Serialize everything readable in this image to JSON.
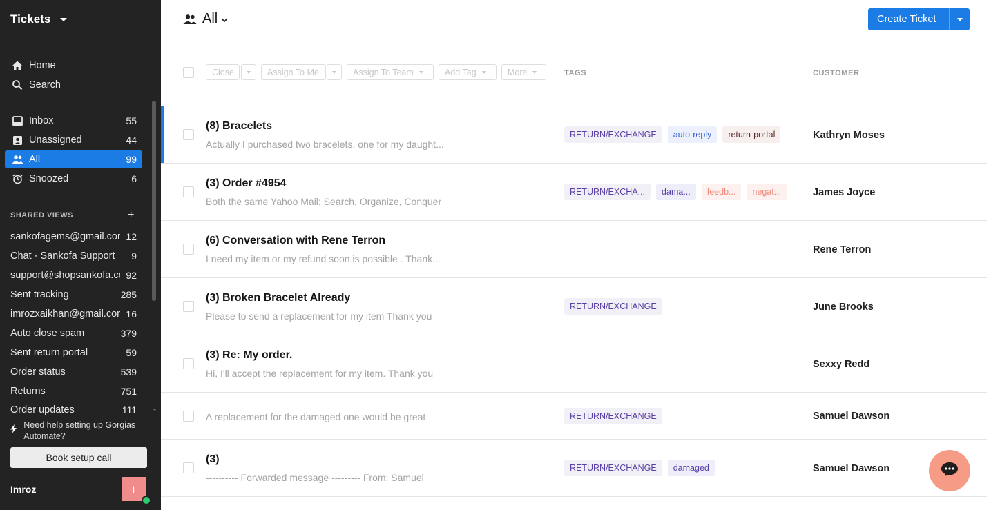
{
  "sidebar": {
    "title": "Tickets",
    "primary_nav": [
      {
        "label": "Home",
        "icon": "home-icon"
      },
      {
        "label": "Search",
        "icon": "search-icon"
      }
    ],
    "views": [
      {
        "label": "Inbox",
        "count": "55",
        "icon": "inbox-icon"
      },
      {
        "label": "Unassigned",
        "count": "44",
        "icon": "unassigned-icon"
      },
      {
        "label": "All",
        "count": "99",
        "icon": "users-icon",
        "active": true
      },
      {
        "label": "Snoozed",
        "count": "6",
        "icon": "alarm-clock-icon"
      }
    ],
    "shared_views_title": "SHARED VIEWS",
    "shared_views_add": "+",
    "shared_views": [
      {
        "label": "sankofagems@gmail.com",
        "count": "12"
      },
      {
        "label": "Chat - Sankofa Support",
        "count": "9"
      },
      {
        "label": "support@shopsankofa.com",
        "count": "92"
      },
      {
        "label": "Sent tracking",
        "count": "285"
      },
      {
        "label": "imrozxaikhan@gmail.com",
        "count": "16"
      },
      {
        "label": "Auto close spam",
        "count": "379"
      },
      {
        "label": "Sent return portal",
        "count": "59"
      },
      {
        "label": "Order status",
        "count": "539"
      },
      {
        "label": "Returns",
        "count": "751"
      },
      {
        "label": "Order updates",
        "count": "111"
      }
    ],
    "help_text": "Need help setting up Gorgias Automate?",
    "book_call_label": "Book setup call",
    "user": {
      "name": "Imroz",
      "initial": "I"
    }
  },
  "header": {
    "view_title": "All",
    "create_ticket_label": "Create Ticket"
  },
  "toolbar": {
    "close_label": "Close",
    "assign_me_label": "Assign To Me",
    "assign_team_label": "Assign To Team",
    "add_tag_label": "Add Tag",
    "more_label": "More"
  },
  "columns": {
    "tags": "TAGS",
    "customer": "CUSTOMER"
  },
  "tickets": [
    {
      "subject": "(8) Bracelets",
      "preview": "Actually I purchased two bracelets, one for my daughter",
      "customer": "Kathryn Moses",
      "tags": [
        {
          "label": "RETURN/EXCHANGE",
          "style": "return"
        },
        {
          "label": "auto-reply",
          "style": "blue"
        },
        {
          "label": "return-portal",
          "style": "brown"
        }
      ]
    },
    {
      "subject": "(3) Order #4954",
      "preview": "Both the same Yahoo Mail: Search, Organize, Conquer",
      "customer": "James Joyce",
      "tags": [
        {
          "label": "RETURN/EXCHA...",
          "style": "return"
        },
        {
          "label": "dama...",
          "style": "purple"
        },
        {
          "label": "feedb...",
          "style": "salmon"
        },
        {
          "label": "negat...",
          "style": "salmon"
        }
      ]
    },
    {
      "subject": "(6) Conversation with Rene Terron",
      "preview": "I need my item or my refund soon is possible . Thank you",
      "customer": "Rene Terron",
      "tags": []
    },
    {
      "subject": "(3) Broken Bracelet Already",
      "preview": "Please to send a replacement for my item Thank you",
      "customer": "June Brooks",
      "tags": [
        {
          "label": "RETURN/EXCHANGE",
          "style": "return"
        }
      ]
    },
    {
      "subject": "(3) Re: My order.",
      "preview": "Hi, I'll accept the replacement for my item. Thank you",
      "customer": "Sexxy Redd",
      "tags": []
    },
    {
      "subject": "",
      "preview": "A replacement for the damaged one would be great",
      "customer": "Samuel Dawson",
      "tags": [
        {
          "label": "RETURN/EXCHANGE",
          "style": "return"
        }
      ]
    },
    {
      "subject": "(3)",
      "preview": "---------- Forwarded message --------- From: Samuel",
      "customer": "Samuel Dawson",
      "tags": [
        {
          "label": "RETURN/EXCHANGE",
          "style": "return"
        },
        {
          "label": "damaged",
          "style": "purple"
        }
      ]
    }
  ],
  "colors": {
    "accent": "#1c7ce6",
    "sidebar_bg": "#232323",
    "chat_bubble": "#f59b86"
  }
}
